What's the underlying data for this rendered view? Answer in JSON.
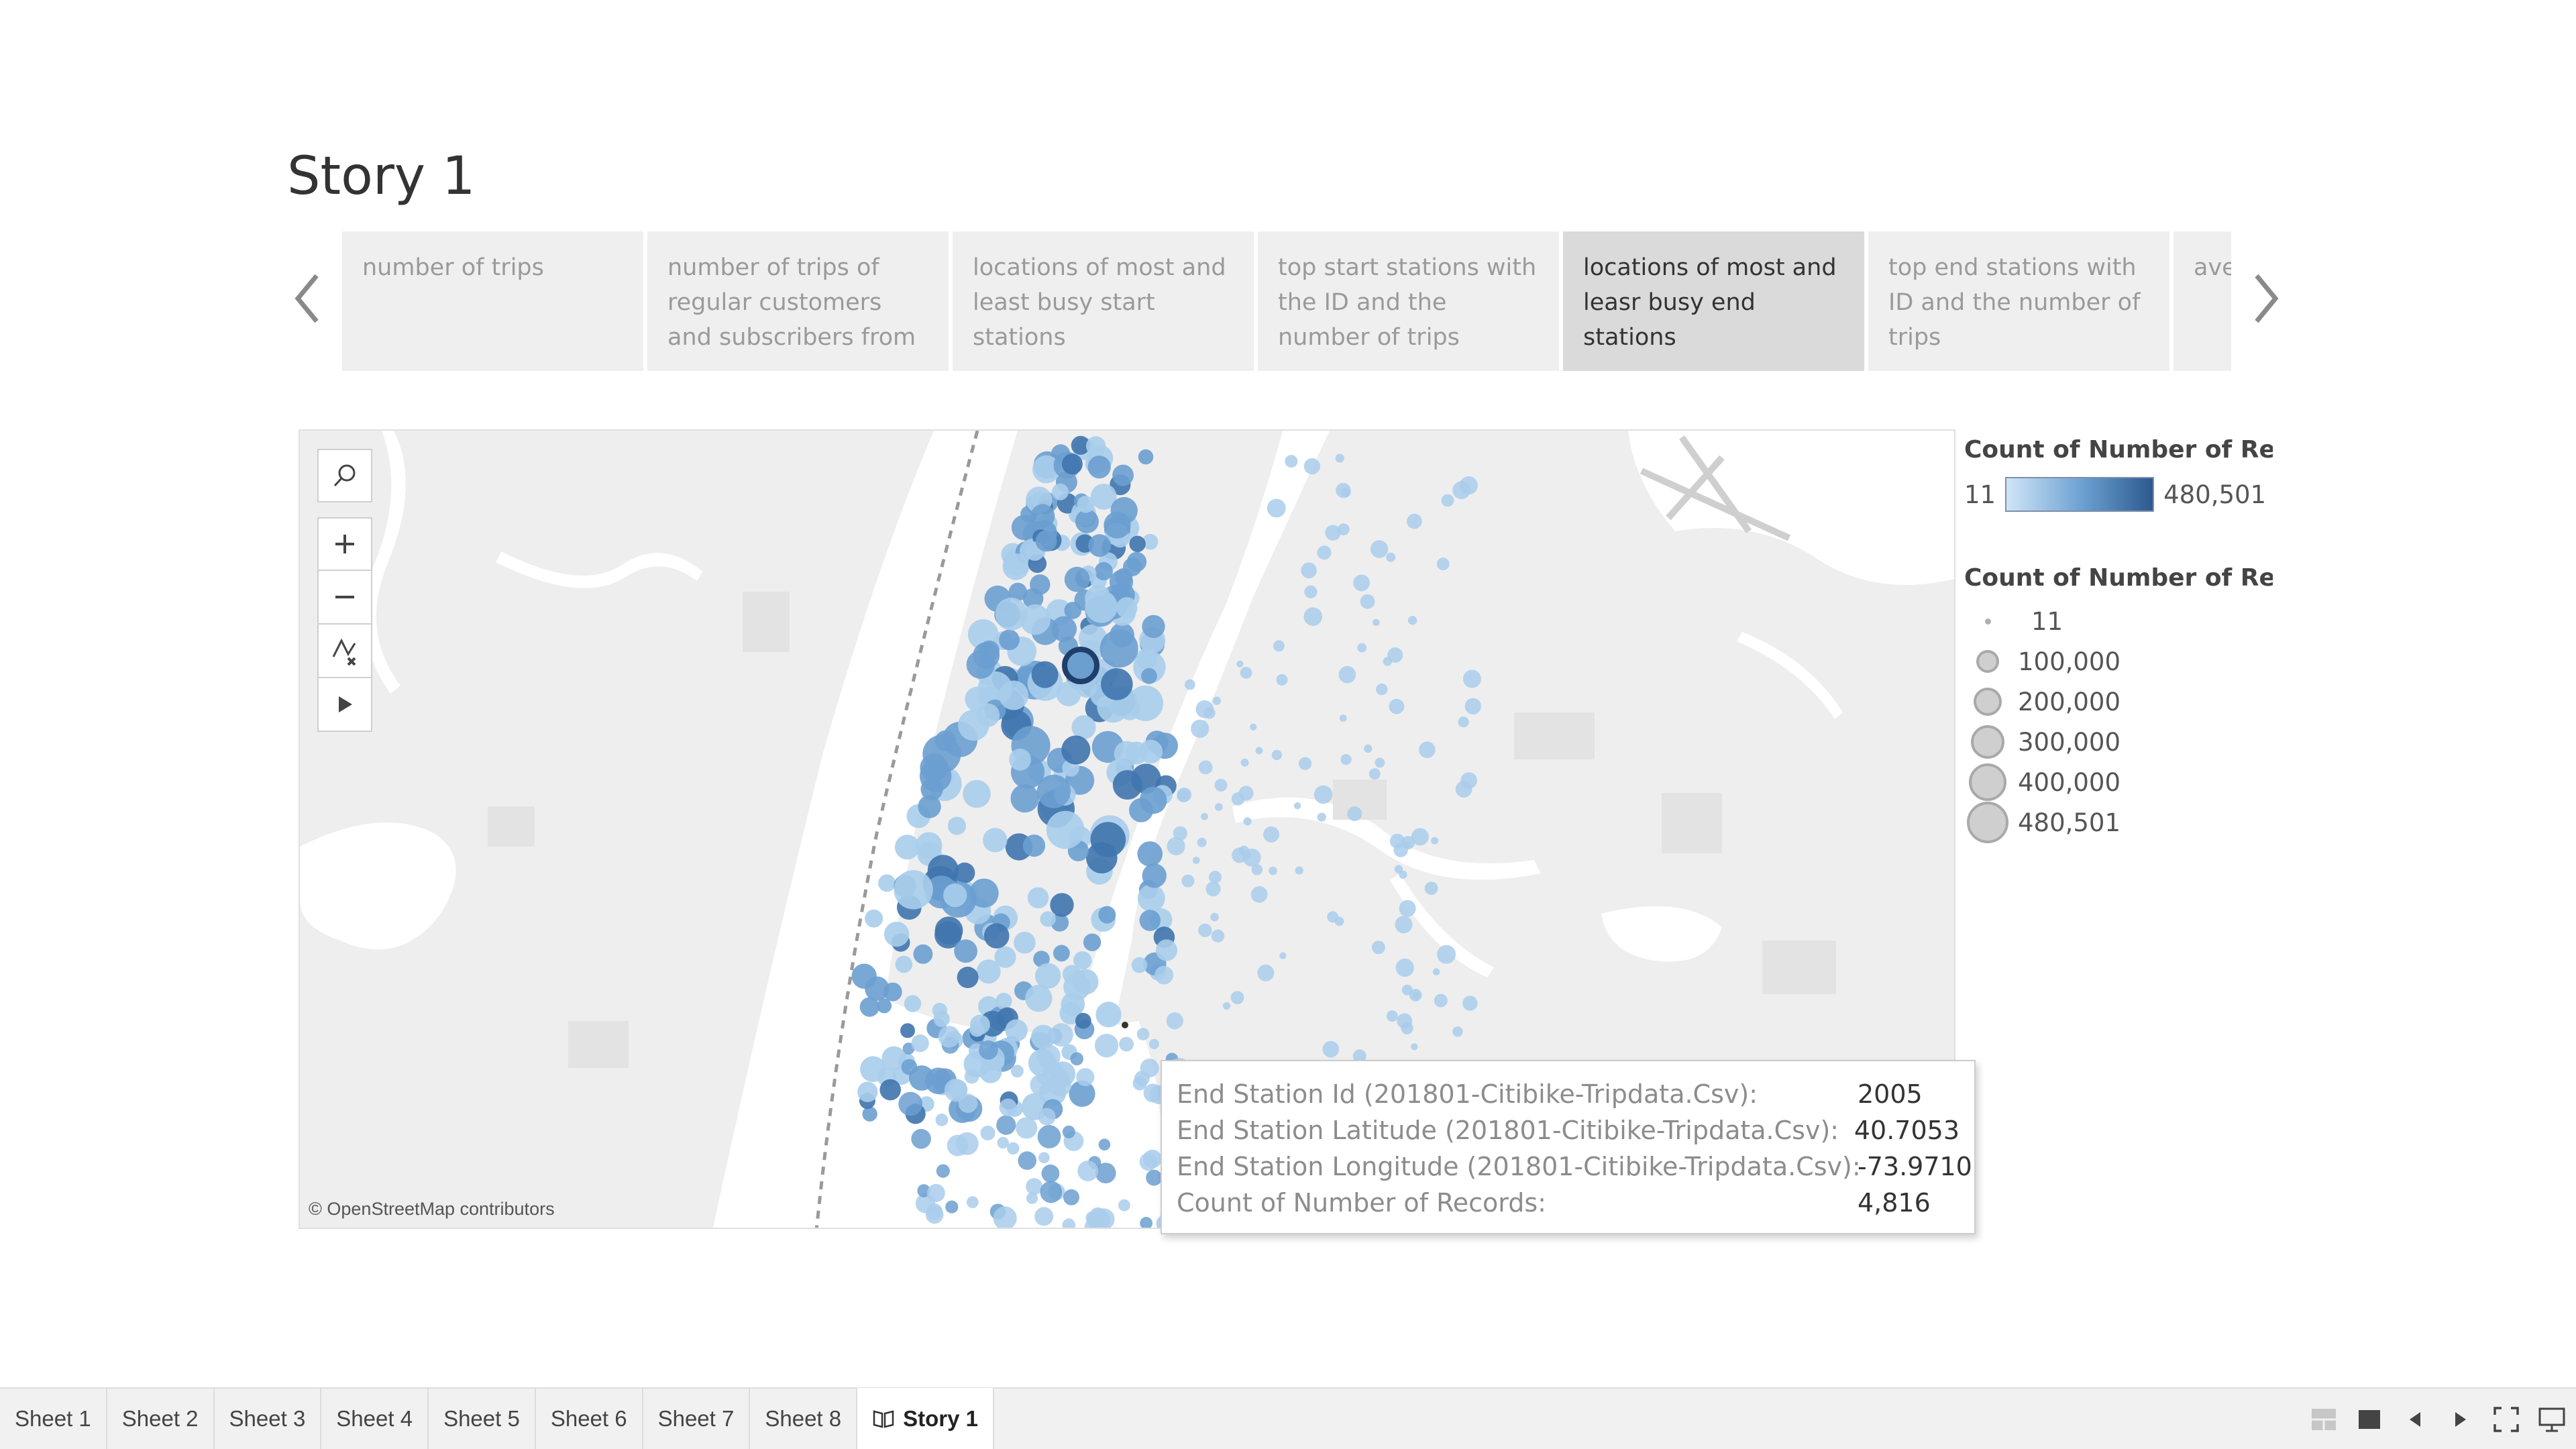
{
  "story": {
    "title": "Story 1",
    "points": [
      {
        "label": "number of trips",
        "active": false
      },
      {
        "label": "number of trips of regular customers and subscribers from",
        "active": false
      },
      {
        "label": "locations  of most and least busy start stations",
        "active": false
      },
      {
        "label": "top start stations with the ID and the number of trips",
        "active": false
      },
      {
        "label": "locations of most and leasr busy end stations",
        "active": true
      },
      {
        "label": "top end stations with ID and the number of trips",
        "active": false
      },
      {
        "label": "ave bas bir",
        "active": false
      }
    ]
  },
  "map": {
    "attribution": "© OpenStreetMap contributors",
    "tools": [
      "search-icon",
      "zoom-in-icon",
      "zoom-out-icon",
      "reset-map-icon",
      "pan-play-icon"
    ]
  },
  "tooltip": {
    "rows": [
      {
        "label": "End Station Id (201801-Citibike-Tripdata.Csv):",
        "value": "2005"
      },
      {
        "label": "End Station Latitude (201801-Citibike-Tripdata.Csv):",
        "value": "40.7053"
      },
      {
        "label": "End Station Longitude (201801-Citibike-Tripdata.Csv):",
        "value": "-73.9710"
      },
      {
        "label": "Count of Number of Records:",
        "value": "4,816"
      }
    ]
  },
  "legend": {
    "color_title": "Count of Number of Recor..",
    "color_min": "11",
    "color_max": "480,501",
    "size_title": "Count of Number of Recor..",
    "size_items": [
      "11",
      "100,000",
      "200,000",
      "300,000",
      "400,000",
      "480,501"
    ]
  },
  "bottom_bar": {
    "tabs": [
      {
        "label": "Sheet 1",
        "active": false
      },
      {
        "label": "Sheet 2",
        "active": false
      },
      {
        "label": "Sheet 3",
        "active": false
      },
      {
        "label": "Sheet 4",
        "active": false
      },
      {
        "label": "Sheet 5",
        "active": false
      },
      {
        "label": "Sheet 6",
        "active": false
      },
      {
        "label": "Sheet 7",
        "active": false
      },
      {
        "label": "Sheet 8",
        "active": false
      },
      {
        "label": "Story 1",
        "active": true
      }
    ]
  },
  "colors": {
    "point_light": "#a9cdeb",
    "point_mid": "#6b9fd0",
    "point_dark": "#3f74ad",
    "water": "#ffffff",
    "land": "#eeeeee"
  }
}
